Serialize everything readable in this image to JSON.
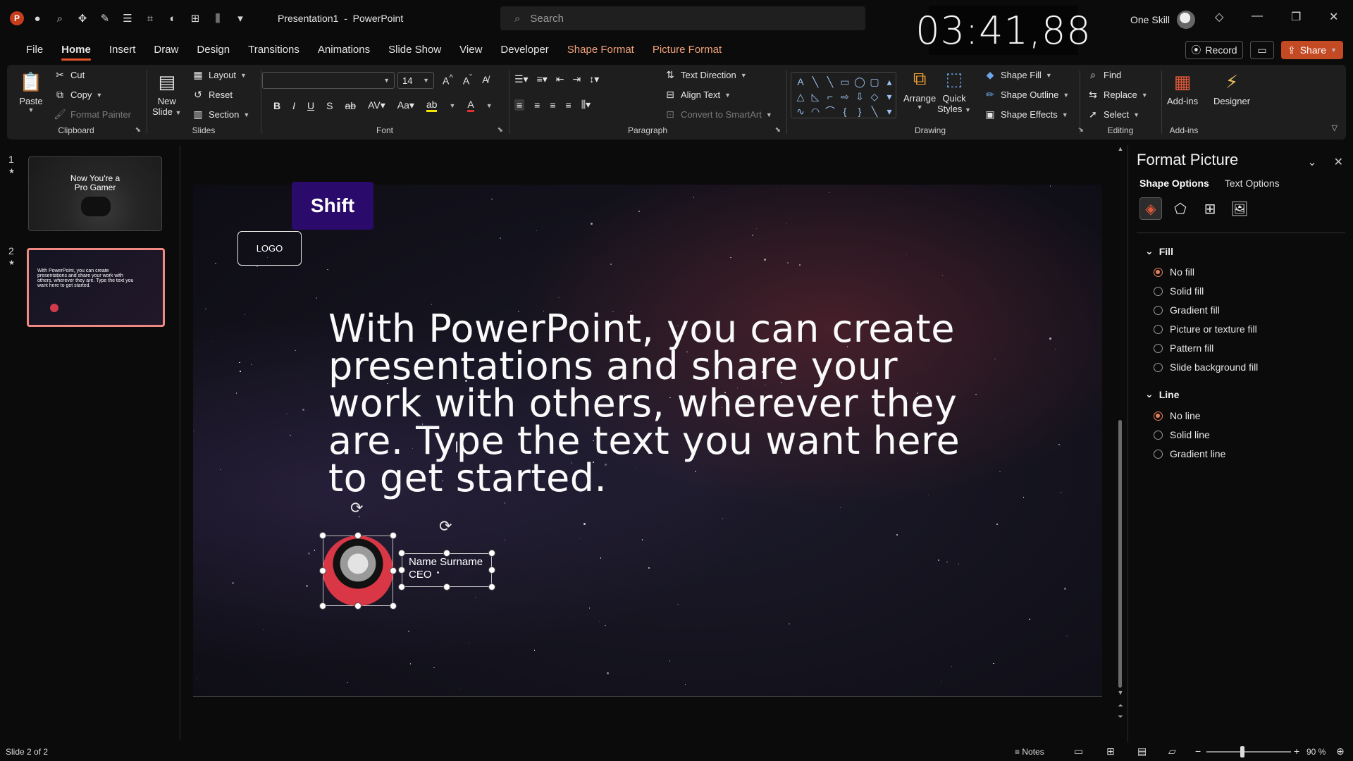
{
  "app": {
    "doc_name": "Presentation1",
    "separator": "-",
    "app_name": "PowerPoint",
    "search_placeholder": "Search",
    "clock": "03:41,88",
    "user_name": "One Skill"
  },
  "tabs": [
    {
      "label": "File"
    },
    {
      "label": "Home"
    },
    {
      "label": "Insert"
    },
    {
      "label": "Draw"
    },
    {
      "label": "Design"
    },
    {
      "label": "Transitions"
    },
    {
      "label": "Animations"
    },
    {
      "label": "Slide Show"
    },
    {
      "label": "View"
    },
    {
      "label": "Developer"
    },
    {
      "label": "Shape Format"
    },
    {
      "label": "Picture Format"
    }
  ],
  "actions": {
    "record": "Record",
    "share": "Share"
  },
  "ribbon": {
    "clipboard": {
      "label": "Clipboard",
      "paste": "Paste",
      "cut": "Cut",
      "copy": "Copy",
      "format_painter": "Format Painter"
    },
    "slides": {
      "label": "Slides",
      "new_slide_1": "New",
      "new_slide_2": "Slide",
      "layout": "Layout",
      "reset": "Reset",
      "section": "Section"
    },
    "font": {
      "label": "Font",
      "font_name": "",
      "font_size": "14"
    },
    "paragraph": {
      "label": "Paragraph",
      "text_direction": "Text Direction",
      "align_text": "Align Text",
      "convert_smartart": "Convert to SmartArt"
    },
    "drawing": {
      "label": "Drawing",
      "arrange": "Arrange",
      "quick_styles_1": "Quick",
      "quick_styles_2": "Styles",
      "shape_fill": "Shape Fill",
      "shape_outline": "Shape Outline",
      "shape_effects": "Shape Effects"
    },
    "editing": {
      "label": "Editing",
      "find": "Find",
      "replace": "Replace",
      "select": "Select"
    },
    "addins": {
      "label": "Add-ins",
      "addins_btn": "Add-ins",
      "designer": "Designer"
    }
  },
  "thumbnails": [
    {
      "num": "1",
      "title_line1": "Now You're a",
      "title_line2": "Pro Gamer"
    },
    {
      "num": "2",
      "text": "With PowerPoint, you can create presentations and share your work with others, wherever they are. Type the text you want here to get started."
    }
  ],
  "slide": {
    "badge": "Shift",
    "logo": "LOGO",
    "body_lines": [
      "With PowerPoint, you can create",
      "presentations and share your",
      "work with others, wherever they",
      "are. Type the text you want here",
      "to get started."
    ],
    "person_name": "Name Surname",
    "person_title": "CEO"
  },
  "pane": {
    "title": "Format Picture",
    "tab_shape": "Shape Options",
    "tab_text": "Text Options",
    "fill_head": "Fill",
    "fill_options": [
      "No fill",
      "Solid fill",
      "Gradient fill",
      "Picture or texture fill",
      "Pattern fill",
      "Slide background fill"
    ],
    "fill_selected": "No fill",
    "line_head": "Line",
    "line_options": [
      "No line",
      "Solid line",
      "Gradient line"
    ],
    "line_selected": "No line"
  },
  "status": {
    "slide_info": "Slide 2 of 2",
    "notes": "Notes",
    "zoom": "90 %"
  },
  "colors": {
    "accent": "#e9552a",
    "share_bg": "#c44a24",
    "badge_bg": "#2a0a6a",
    "context_tab": "#f0a17a",
    "selected_thumb_border": "#f08a80"
  }
}
